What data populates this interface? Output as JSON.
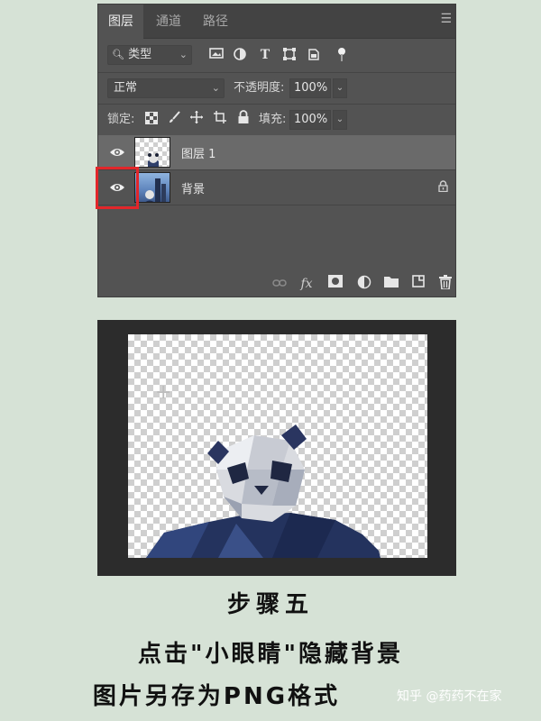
{
  "panel": {
    "tabs": [
      {
        "label": "图层",
        "active": true
      },
      {
        "label": "通道",
        "active": false
      },
      {
        "label": "路径",
        "active": false
      }
    ],
    "menu_icon": "panel-menu-icon",
    "filter": {
      "value": "类型",
      "search_icon": "search-icon"
    },
    "blend_mode": {
      "value": "正常"
    },
    "opacity": {
      "label": "不透明度:",
      "value": "100%"
    },
    "lock": {
      "label": "锁定:"
    },
    "fill": {
      "label": "填充:",
      "value": "100%"
    },
    "layers": [
      {
        "name": "图层 1",
        "visible": true,
        "selected": true,
        "locked": false
      },
      {
        "name": "背景",
        "visible": true,
        "selected": false,
        "locked": true
      }
    ],
    "bottom_icons": [
      "link-icon",
      "fx-icon",
      "mask-icon",
      "adjustment-icon",
      "group-folder-icon",
      "new-layer-icon",
      "trash-icon"
    ],
    "fx_label": "fx"
  },
  "caption": {
    "line1": "步骤五",
    "line2": "点击\"小眼睛\"隐藏背景",
    "line3": "图片另存为PNG格式"
  },
  "watermark": "知乎 @药药不在家",
  "colors": {
    "highlight": "#e2262a",
    "panel_bg": "#535353",
    "page_bg": "#d6e2d6"
  }
}
